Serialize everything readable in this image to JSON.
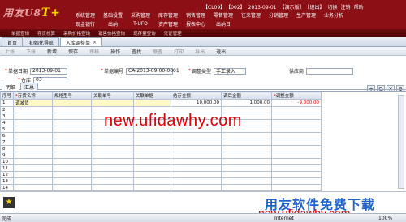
{
  "header": {
    "logo_text": "用友U8",
    "logo_plus": "T+",
    "status_items": [
      "【CL09】",
      "【002】",
      "2013-09-01",
      "【演示版】",
      "【退出】",
      "切换",
      "注销",
      "帮助"
    ]
  },
  "menu": {
    "row1": [
      "系统管理",
      "基础设置",
      "采购管理",
      "库存管理",
      "销售管理",
      "零售管理",
      "往来管理",
      "分销管理",
      "生产管理",
      "业务分析"
    ],
    "row2": [
      "现金银行",
      "出纳",
      "T-UFO",
      "资产管理",
      "报表中心",
      "出纳日"
    ]
  },
  "quickbar": [
    "单据查询",
    "存货核算",
    "采购价格查询",
    "销售价格查询",
    "现存量查询",
    "凭证管理"
  ],
  "tabs": [
    {
      "label": "首页",
      "active": false
    },
    {
      "label": "初始化导航",
      "active": false
    },
    {
      "label": "入库调整单",
      "active": true,
      "closable": true
    }
  ],
  "toolbar": {
    "items": [
      {
        "label": "上张",
        "disabled": true
      },
      {
        "label": "下张",
        "disabled": true
      },
      {
        "label": "新增",
        "disabled": false
      },
      {
        "label": "保存",
        "disabled": false
      },
      {
        "label": "审核",
        "disabled": true
      },
      {
        "label": "操作",
        "disabled": false
      },
      {
        "label": "查找",
        "disabled": false
      },
      {
        "label": "联查",
        "disabled": true
      },
      {
        "label": "打印",
        "disabled": true
      },
      {
        "label": "导出",
        "disabled": true
      },
      {
        "label": "退出",
        "disabled": false
      }
    ]
  },
  "form": {
    "date_label": "单据日期",
    "date_value": "2013-09-01",
    "code_label": "单据编号",
    "code_value": "CA-2013-09-00-0001",
    "type_label": "调整类型",
    "type_value": "手工录入",
    "supplier_label": "供应商",
    "supplier_value": "",
    "warehouse_label": "仓库",
    "warehouse_value": "03"
  },
  "subtabs": [
    "明细",
    "汇总"
  ],
  "grid": {
    "headers": [
      "序号",
      "存货名称",
      "规格型号",
      "关联单号",
      "关联单据",
      "结存金额",
      "调后金额",
      "调整金额"
    ],
    "required_headers": [
      1,
      7
    ],
    "rows": [
      [
        "1",
        "调减货",
        "",
        "",
        "",
        "10,000.00",
        "1,000.00",
        "-9,000.00"
      ],
      [
        "2",
        "",
        "",
        "",
        "",
        "",
        "",
        ""
      ],
      [
        "3",
        "",
        "",
        "",
        "",
        "",
        "",
        ""
      ],
      [
        "4",
        "",
        "",
        "",
        "",
        "",
        "",
        ""
      ],
      [
        "5",
        "",
        "",
        "",
        "",
        "",
        "",
        ""
      ],
      [
        "6",
        "",
        "",
        "",
        "",
        "",
        "",
        ""
      ],
      [
        "7",
        "",
        "",
        "",
        "",
        "",
        "",
        ""
      ],
      [
        "8",
        "",
        "",
        "",
        "",
        "",
        "",
        ""
      ],
      [
        "9",
        "",
        "",
        "",
        "",
        "",
        "",
        ""
      ],
      [
        "10",
        "",
        "",
        "",
        "",
        "",
        "",
        ""
      ],
      [
        "11",
        "",
        "",
        "",
        "",
        "",
        "",
        ""
      ],
      [
        "12",
        "",
        "",
        "",
        "",
        "",
        "",
        ""
      ],
      [
        "13",
        "",
        "",
        "",
        "",
        "",
        "",
        ""
      ],
      [
        "14",
        "",
        "",
        "",
        "",
        "",
        "",
        ""
      ]
    ]
  },
  "watermark": {
    "url": "new.ufidawhy.com",
    "brand_cn": "用友软件免费下载",
    "brand_en": "new.ufidawhy.com"
  },
  "statusbar": {
    "left": "完成",
    "zone": "Internet",
    "zoom": "100%"
  }
}
